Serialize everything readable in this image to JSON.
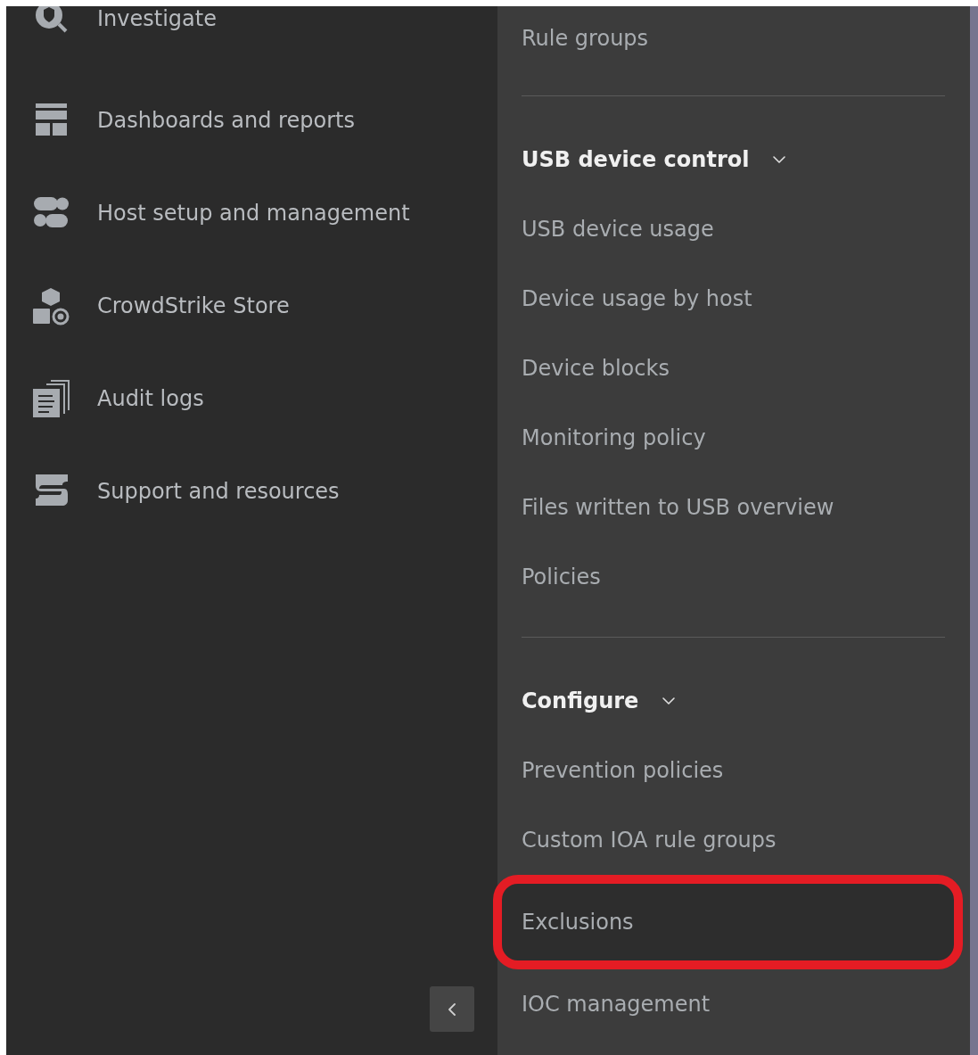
{
  "sidebar": {
    "items": [
      {
        "label": "Investigate"
      },
      {
        "label": "Dashboards and reports"
      },
      {
        "label": "Host setup and management"
      },
      {
        "label": "CrowdStrike Store"
      },
      {
        "label": "Audit logs"
      },
      {
        "label": "Support and resources"
      }
    ]
  },
  "submenu": {
    "sections": [
      {
        "items": [
          {
            "label": "Rule groups",
            "selected": false
          }
        ]
      },
      {
        "header": "USB device control",
        "expanded": true,
        "items": [
          {
            "label": "USB device usage",
            "selected": false
          },
          {
            "label": "Device usage by host",
            "selected": false
          },
          {
            "label": "Device blocks",
            "selected": false
          },
          {
            "label": "Monitoring policy",
            "selected": false
          },
          {
            "label": "Files written to USB overview",
            "selected": false
          },
          {
            "label": "Policies",
            "selected": false
          }
        ]
      },
      {
        "header": "Configure",
        "expanded": true,
        "items": [
          {
            "label": "Prevention policies",
            "selected": false
          },
          {
            "label": "Custom IOA rule groups",
            "selected": false
          },
          {
            "label": "Exclusions",
            "selected": true
          },
          {
            "label": "IOC management",
            "selected": false
          }
        ]
      }
    ]
  }
}
